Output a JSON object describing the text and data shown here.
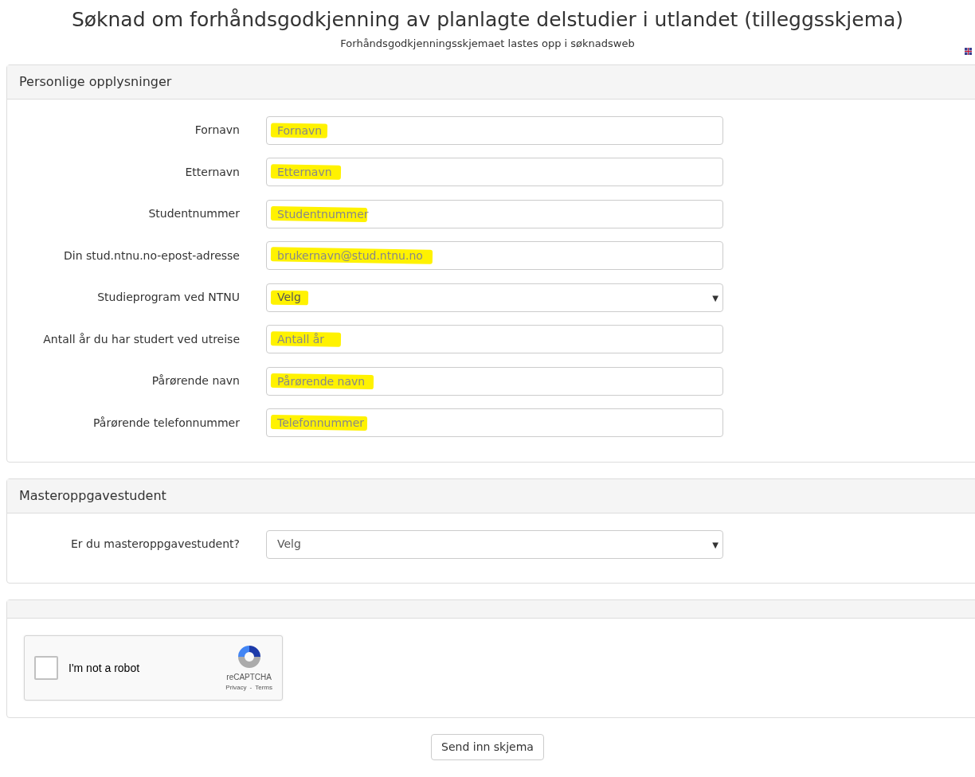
{
  "title": "Søknad om forhåndsgodkjenning av planlagte delstudier i utlandet (tilleggsskjema)",
  "subtitle": "Forhåndsgodkjenningsskjemaet lastes opp i søknadsweb",
  "sections": [
    {
      "heading": "Personlige opplysninger",
      "fields": [
        {
          "kind": "text",
          "label": "Fornavn",
          "placeholder": "Fornavn",
          "highlighted": true
        },
        {
          "kind": "text",
          "label": "Etternavn",
          "placeholder": "Etternavn",
          "highlighted": true
        },
        {
          "kind": "text",
          "label": "Studentnummer",
          "placeholder": "Studentnummer",
          "highlighted": true
        },
        {
          "kind": "text",
          "label": "Din stud.ntnu.no-epost-adresse",
          "placeholder": "brukernavn@stud.ntnu.no",
          "highlighted": true
        },
        {
          "kind": "select",
          "label": "Studieprogram ved NTNU",
          "value": "Velg",
          "caret": "▼",
          "highlighted": true
        },
        {
          "kind": "text",
          "label": "Antall år du har studert ved utreise",
          "placeholder": "Antall år",
          "highlighted": true
        },
        {
          "kind": "text",
          "label": "Pårørende navn",
          "placeholder": "Pårørende navn",
          "highlighted": true
        },
        {
          "kind": "text",
          "label": "Pårørende telefonnummer",
          "placeholder": "Telefonnummer",
          "highlighted": true
        }
      ]
    },
    {
      "heading": "Masteroppgavestudent",
      "fields": [
        {
          "kind": "select",
          "label": "Er du masteroppgavestudent?",
          "value": "Velg",
          "caret": "▼",
          "highlighted": false
        }
      ]
    },
    {
      "captcha": {
        "label": "I'm not a robot",
        "checked": false,
        "brand": "reCAPTCHA",
        "privacy": "Privacy",
        "separator": "-",
        "terms": "Terms"
      }
    }
  ],
  "submit": "Send inn skjema"
}
